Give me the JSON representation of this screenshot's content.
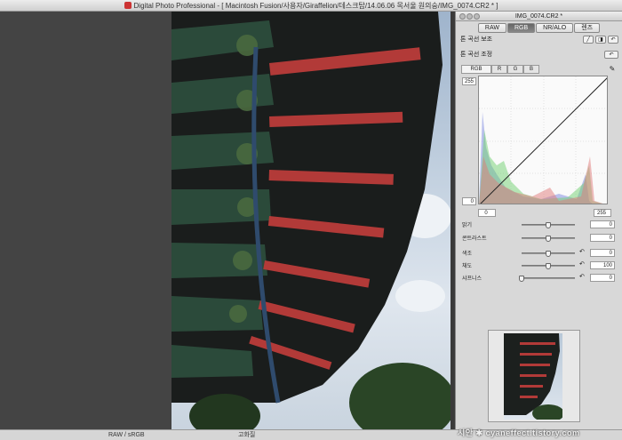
{
  "window": {
    "title": "Digital Photo Professional - [ Macintosh Fusion/사용자/Giraffelion/데스크탑/14.06.06 목서울 원의숭/IMG_0074.CR2 * ]"
  },
  "panel": {
    "title": "IMG_0074.CR2 *",
    "tabs": [
      "RAW",
      "RGB",
      "NR/ALO",
      "렌즈"
    ],
    "active_tab": "RGB",
    "section1": "톤 곡선 보조",
    "section2": "톤 곡선 조정",
    "channel_tabs": [
      "RGB",
      "R",
      "G",
      "B"
    ],
    "curve": {
      "in_max": "255",
      "in_min": "0",
      "out_min": "0",
      "out_max": "255"
    },
    "sliders": [
      {
        "name": "밝기",
        "value": "0",
        "position": 0.5
      },
      {
        "name": "콘트라스트",
        "value": "0",
        "position": 0.5
      },
      {
        "name": "색조",
        "value": "0",
        "position": 0.5
      },
      {
        "name": "채도",
        "value": "100",
        "position": 0.5
      },
      {
        "name": "샤프니스",
        "value": "0",
        "position": 0.0
      }
    ]
  },
  "status": {
    "left": "RAW / sRGB",
    "middle": "고화질"
  },
  "watermark": "시안 ✱ cyaneffect.tistory.com",
  "icons": {
    "curve_assist_auto": "auto-adjust-icon",
    "curve_assist_reset": "reset-icon",
    "picker": "eyedropper-icon"
  }
}
